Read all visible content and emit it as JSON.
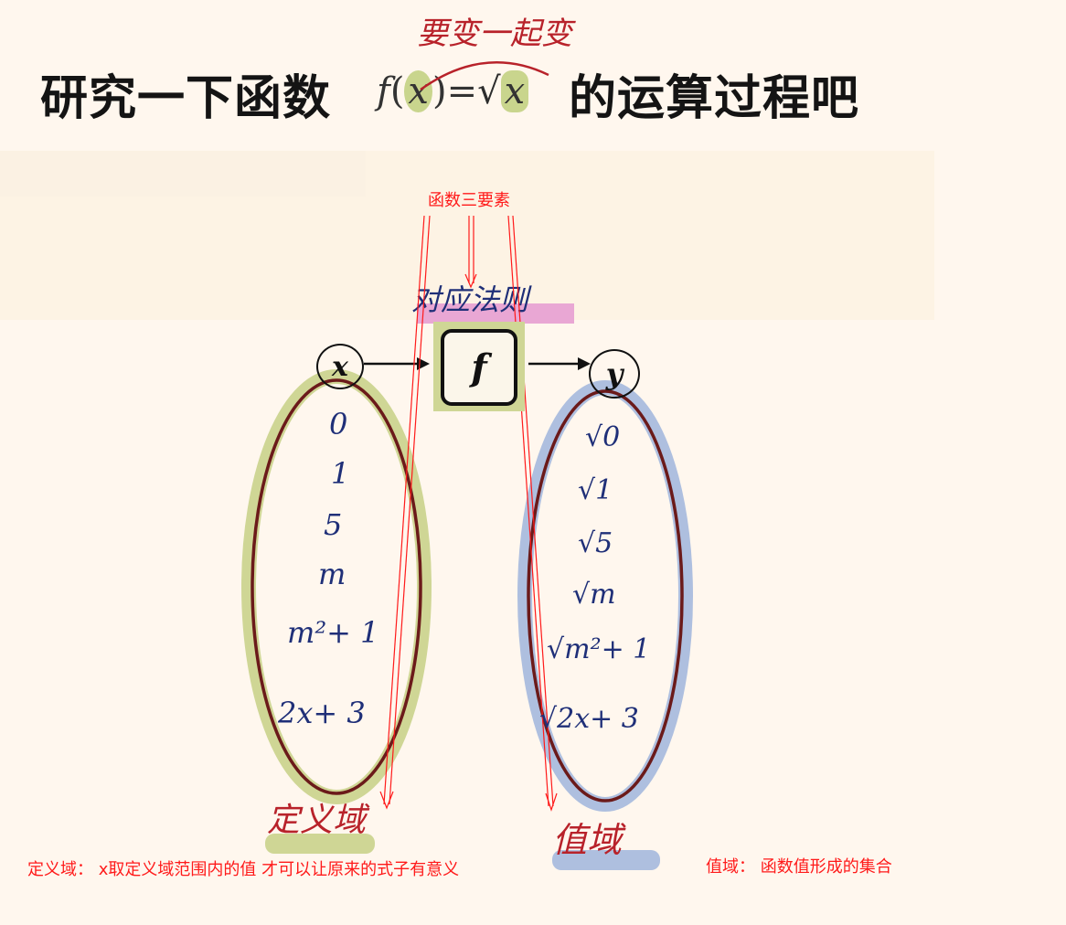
{
  "title": {
    "left_text": "研究一下函数",
    "func_name": "f",
    "arg": "x",
    "equals": "=",
    "root_sign": "√",
    "root_arg": "x",
    "right_text": "的运算过程吧"
  },
  "handwriting": {
    "top_note": "要变一起变",
    "correspondence_rule": "对应法则",
    "domain_label": "定义域",
    "range_label": "值域"
  },
  "diagram": {
    "input_var": "x",
    "func_box": "f",
    "output_var": "y",
    "inputs": [
      "0",
      "1",
      "5",
      "m",
      "m²+ 1",
      "2x+ 3"
    ],
    "outputs": [
      "√0",
      "√1",
      "√5",
      "√m",
      "√m²+ 1",
      "√2x+ 3"
    ]
  },
  "annotations": {
    "three_elements": "函数三要素",
    "domain_def": "定义域：  x取定义域范围内的值 才可以让原来的式子有意义",
    "range_def": "值域：  函数值形成的集合"
  },
  "colors": {
    "background": "#fff7ee",
    "annotation_red": "#ff1a1a",
    "ink_blue": "#1f2f78",
    "ink_red": "#b8222a",
    "highlight_green": "#c9d58d",
    "highlight_blue": "#aebfdf",
    "highlight_pink": "#e9a7d4"
  }
}
